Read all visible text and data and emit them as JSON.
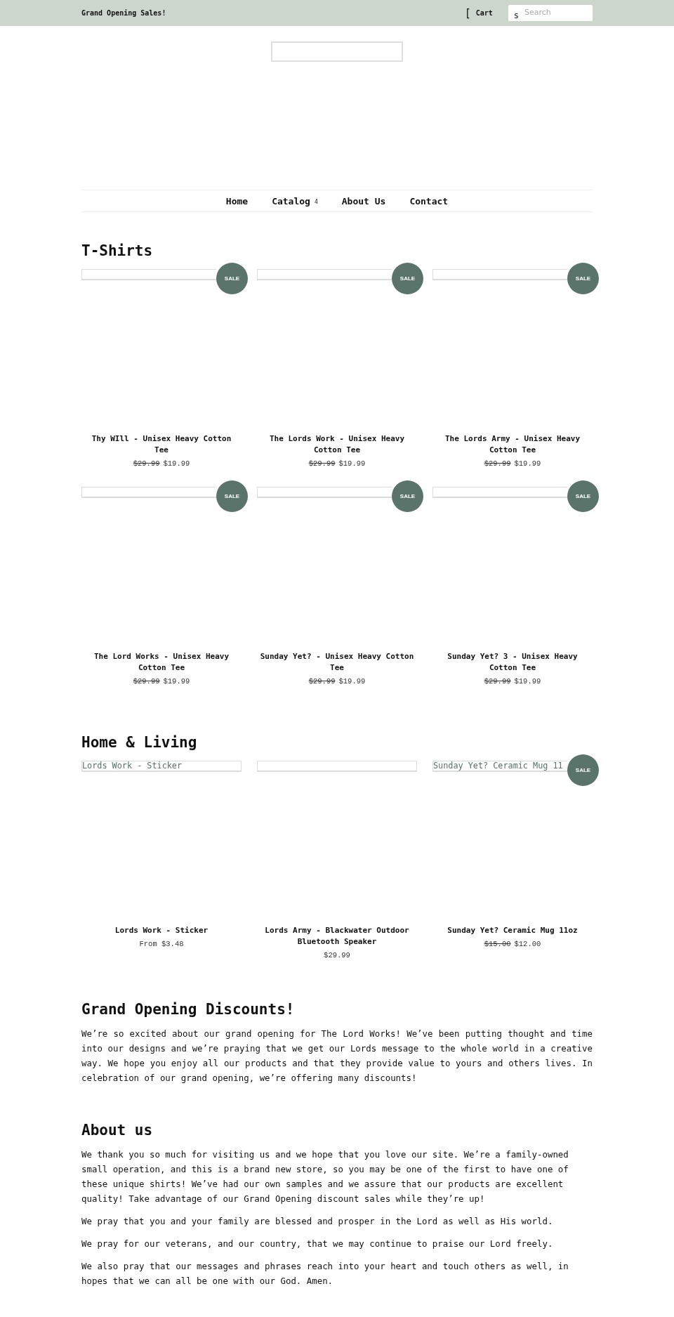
{
  "announcement_bar": {
    "message": "Grand Opening Sales!",
    "cart": {
      "glyph": "[",
      "label": "Cart"
    },
    "search": {
      "glyph": "s",
      "placeholder": "Search"
    }
  },
  "navigation": [
    {
      "label": "Home"
    },
    {
      "label": "Catalog",
      "dropdown_glyph": "4"
    },
    {
      "label": "About Us"
    },
    {
      "label": "Contact"
    }
  ],
  "collections": [
    {
      "title": "T-Shirts",
      "products": [
        {
          "badge": "SALE",
          "title": "Thy WIll - Unisex Heavy Cotton Tee",
          "compare_price": "$29.99",
          "price": "$19.99"
        },
        {
          "badge": "SALE",
          "title": "The Lords Work - Unisex Heavy Cotton Tee",
          "compare_price": "$29.99",
          "price": "$19.99"
        },
        {
          "badge": "SALE",
          "title": "The Lords Army - Unisex Heavy Cotton Tee",
          "compare_price": "$29.99",
          "price": "$19.99"
        },
        {
          "badge": "SALE",
          "title": "The Lord Works - Unisex Heavy Cotton Tee",
          "compare_price": "$29.99",
          "price": "$19.99"
        },
        {
          "badge": "SALE",
          "title": "Sunday Yet? - Unisex Heavy Cotton Tee",
          "compare_price": "$29.99",
          "price": "$19.99"
        },
        {
          "badge": "SALE",
          "title": "Sunday Yet? 3 - Unisex Heavy Cotton Tee",
          "compare_price": "$29.99",
          "price": "$19.99"
        }
      ]
    },
    {
      "title": "Home & Living",
      "products": [
        {
          "image_alt": "Lords Work - Sticker",
          "title": "Lords Work - Sticker",
          "price": "From $3.48"
        },
        {
          "title": "Lords Army - Blackwater Outdoor Bluetooth Speaker",
          "price": "$29.99"
        },
        {
          "image_alt": "Sunday Yet? Ceramic Mug 11",
          "badge": "SALE",
          "title": "Sunday Yet? Ceramic Mug 11oz",
          "compare_price": "$15.00",
          "price": "$12.00"
        }
      ]
    }
  ],
  "text_sections": [
    {
      "kind": "promo",
      "heading": "Grand Opening Discounts!",
      "paragraphs": [
        "We’re so excited about our grand opening for The Lord Works! We’ve been putting thought and time into our designs and we’re praying that we get our Lords message to the whole world in a creative way. We hope you enjoy all our products and that they provide value to yours and others lives. In celebration of our grand opening, we’re offering many discounts!"
      ]
    },
    {
      "kind": "about",
      "heading": "About us",
      "paragraphs": [
        "We thank you so much for visiting us and we hope that you love our site. We’re a family-owned small operation, and this is a brand new store, so you may be one of the first to have one of these unique shirts! We’ve had our own samples and we assure that our products are excellent quality! Take advantage of our Grand Opening discount sales while they’re up!",
        "We pray that you and your family are blessed and prosper in the Lord as well as His world.",
        "We pray for our veterans, and our country, that we may continue to praise our Lord freely.",
        "We also pray that our messages and phrases reach into your heart and touch others as well, in hopes that we can all be one with our God. Amen."
      ]
    }
  ]
}
